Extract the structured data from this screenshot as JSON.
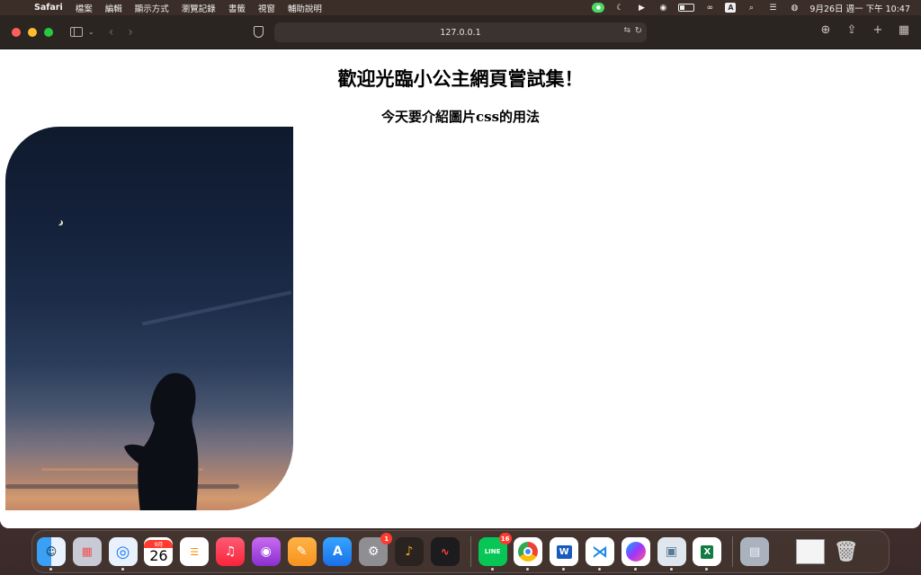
{
  "menubar": {
    "app_name": "Safari",
    "items": [
      "檔案",
      "編輯",
      "顯示方式",
      "瀏覽記錄",
      "書籤",
      "視窗",
      "輔助說明"
    ],
    "clock": "9月26日 週一 下午 10:47"
  },
  "browser": {
    "url": "127.0.0.1"
  },
  "page": {
    "heading": "歡迎光臨小公主網頁嘗試集！",
    "subheading": "今天要介紹圖片css的用法"
  },
  "dock": {
    "calendar_month": "9月",
    "calendar_day": "26",
    "settings_badge": "1",
    "line_badge": "16",
    "word_letter": "W",
    "excel_letter": "X",
    "line_label": "LINE"
  },
  "colors": {
    "traffic_red": "#ff5f57",
    "traffic_yellow": "#febc2e",
    "traffic_green": "#28c840",
    "badge_red": "#ff3b30"
  }
}
